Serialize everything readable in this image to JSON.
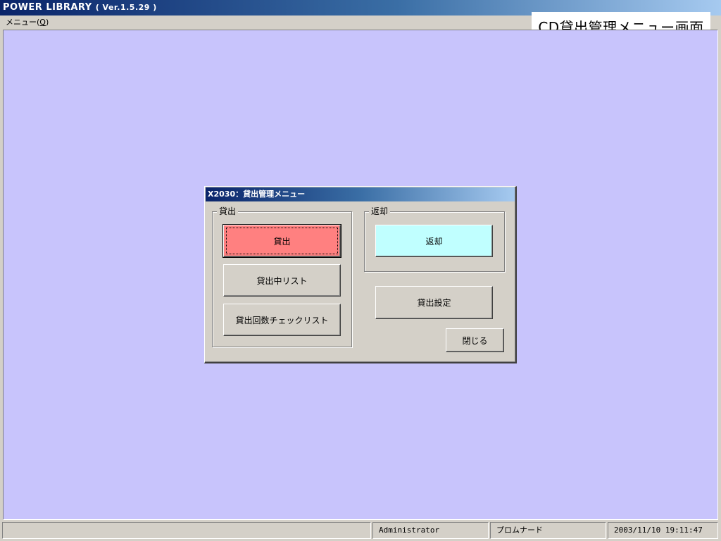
{
  "window": {
    "title": "POWER  LIBRARY",
    "version": "( Ver.1.5.29 )"
  },
  "menubar": {
    "menu_label": "メニュー(",
    "menu_accel": "Q",
    "menu_close": ")"
  },
  "caption": "CD貸出管理メニュー画面",
  "dialog": {
    "title": "X2030：貸出管理メニュー",
    "lend_group": {
      "legend": "貸出",
      "buttons": {
        "lend": "貸出",
        "lending_list": "貸出中リスト",
        "lend_count_checklist": "貸出回数チェックリスト"
      }
    },
    "return_group": {
      "legend": "返却",
      "buttons": {
        "return": "返却"
      }
    },
    "lend_settings": "貸出設定",
    "close": "閉じる"
  },
  "colors": {
    "lend_button": "#ff8080",
    "return_button": "#c0ffff",
    "workspace": "#c8c4fc"
  },
  "statusbar": {
    "panel_1": "",
    "user": "Administrator",
    "location": "プロムナード",
    "datetime": "2003/11/10 19:11:47"
  }
}
